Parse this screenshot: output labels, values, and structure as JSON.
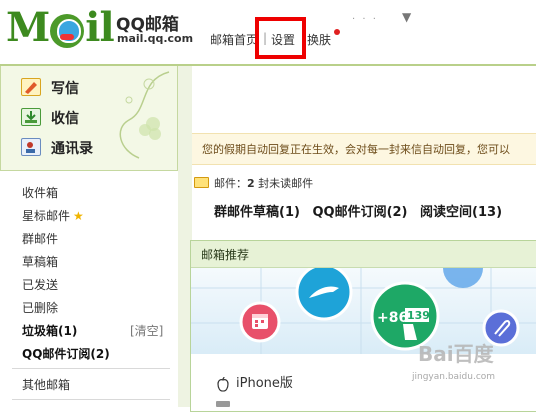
{
  "header": {
    "logo_text": "MOil",
    "brand": "QQ邮箱",
    "url": "mail.qq.com",
    "nav": {
      "home": "邮箱首页",
      "sep": "|",
      "settings": "设置",
      "skin": "换肤"
    },
    "dots": "· · ·",
    "caret": "▼"
  },
  "sidebar": {
    "actions": [
      {
        "label": "写信",
        "icon": "compose-icon"
      },
      {
        "label": "收信",
        "icon": "inbox-download-icon"
      },
      {
        "label": "通讯录",
        "icon": "contacts-icon"
      }
    ],
    "folders": [
      {
        "label": "收件箱"
      },
      {
        "label": "星标邮件",
        "star": "★"
      },
      {
        "label": "群邮件"
      },
      {
        "label": "草稿箱"
      },
      {
        "label": "已发送"
      },
      {
        "label": "已删除"
      },
      {
        "label": "垃圾箱(1)",
        "action": "[清空]"
      },
      {
        "label": "QQ邮件订阅(2)"
      }
    ],
    "other": "其他邮箱"
  },
  "main": {
    "notice": "您的假期自动回复正在生效，会对每一封来信自动回复，您可以",
    "mail_label": "邮件：",
    "mail_count": "2",
    "mail_suffix": " 封未读邮件",
    "links": [
      "群邮件草稿(1)",
      "QQ邮件订阅(2)",
      "阅读空间(13)"
    ],
    "recommend": {
      "title": "邮箱推荐",
      "badge_text": "+86",
      "badge_num": "139",
      "iphone": "iPhone版"
    },
    "watermark": "Bai百度",
    "watermark_url": "jingyan.baidu.com"
  },
  "colors": {
    "brand_green": "#3d8a1f",
    "highlight_red": "#e00000",
    "notice_bg": "#fdf7e1",
    "panel_green": "#e7f2d6"
  }
}
